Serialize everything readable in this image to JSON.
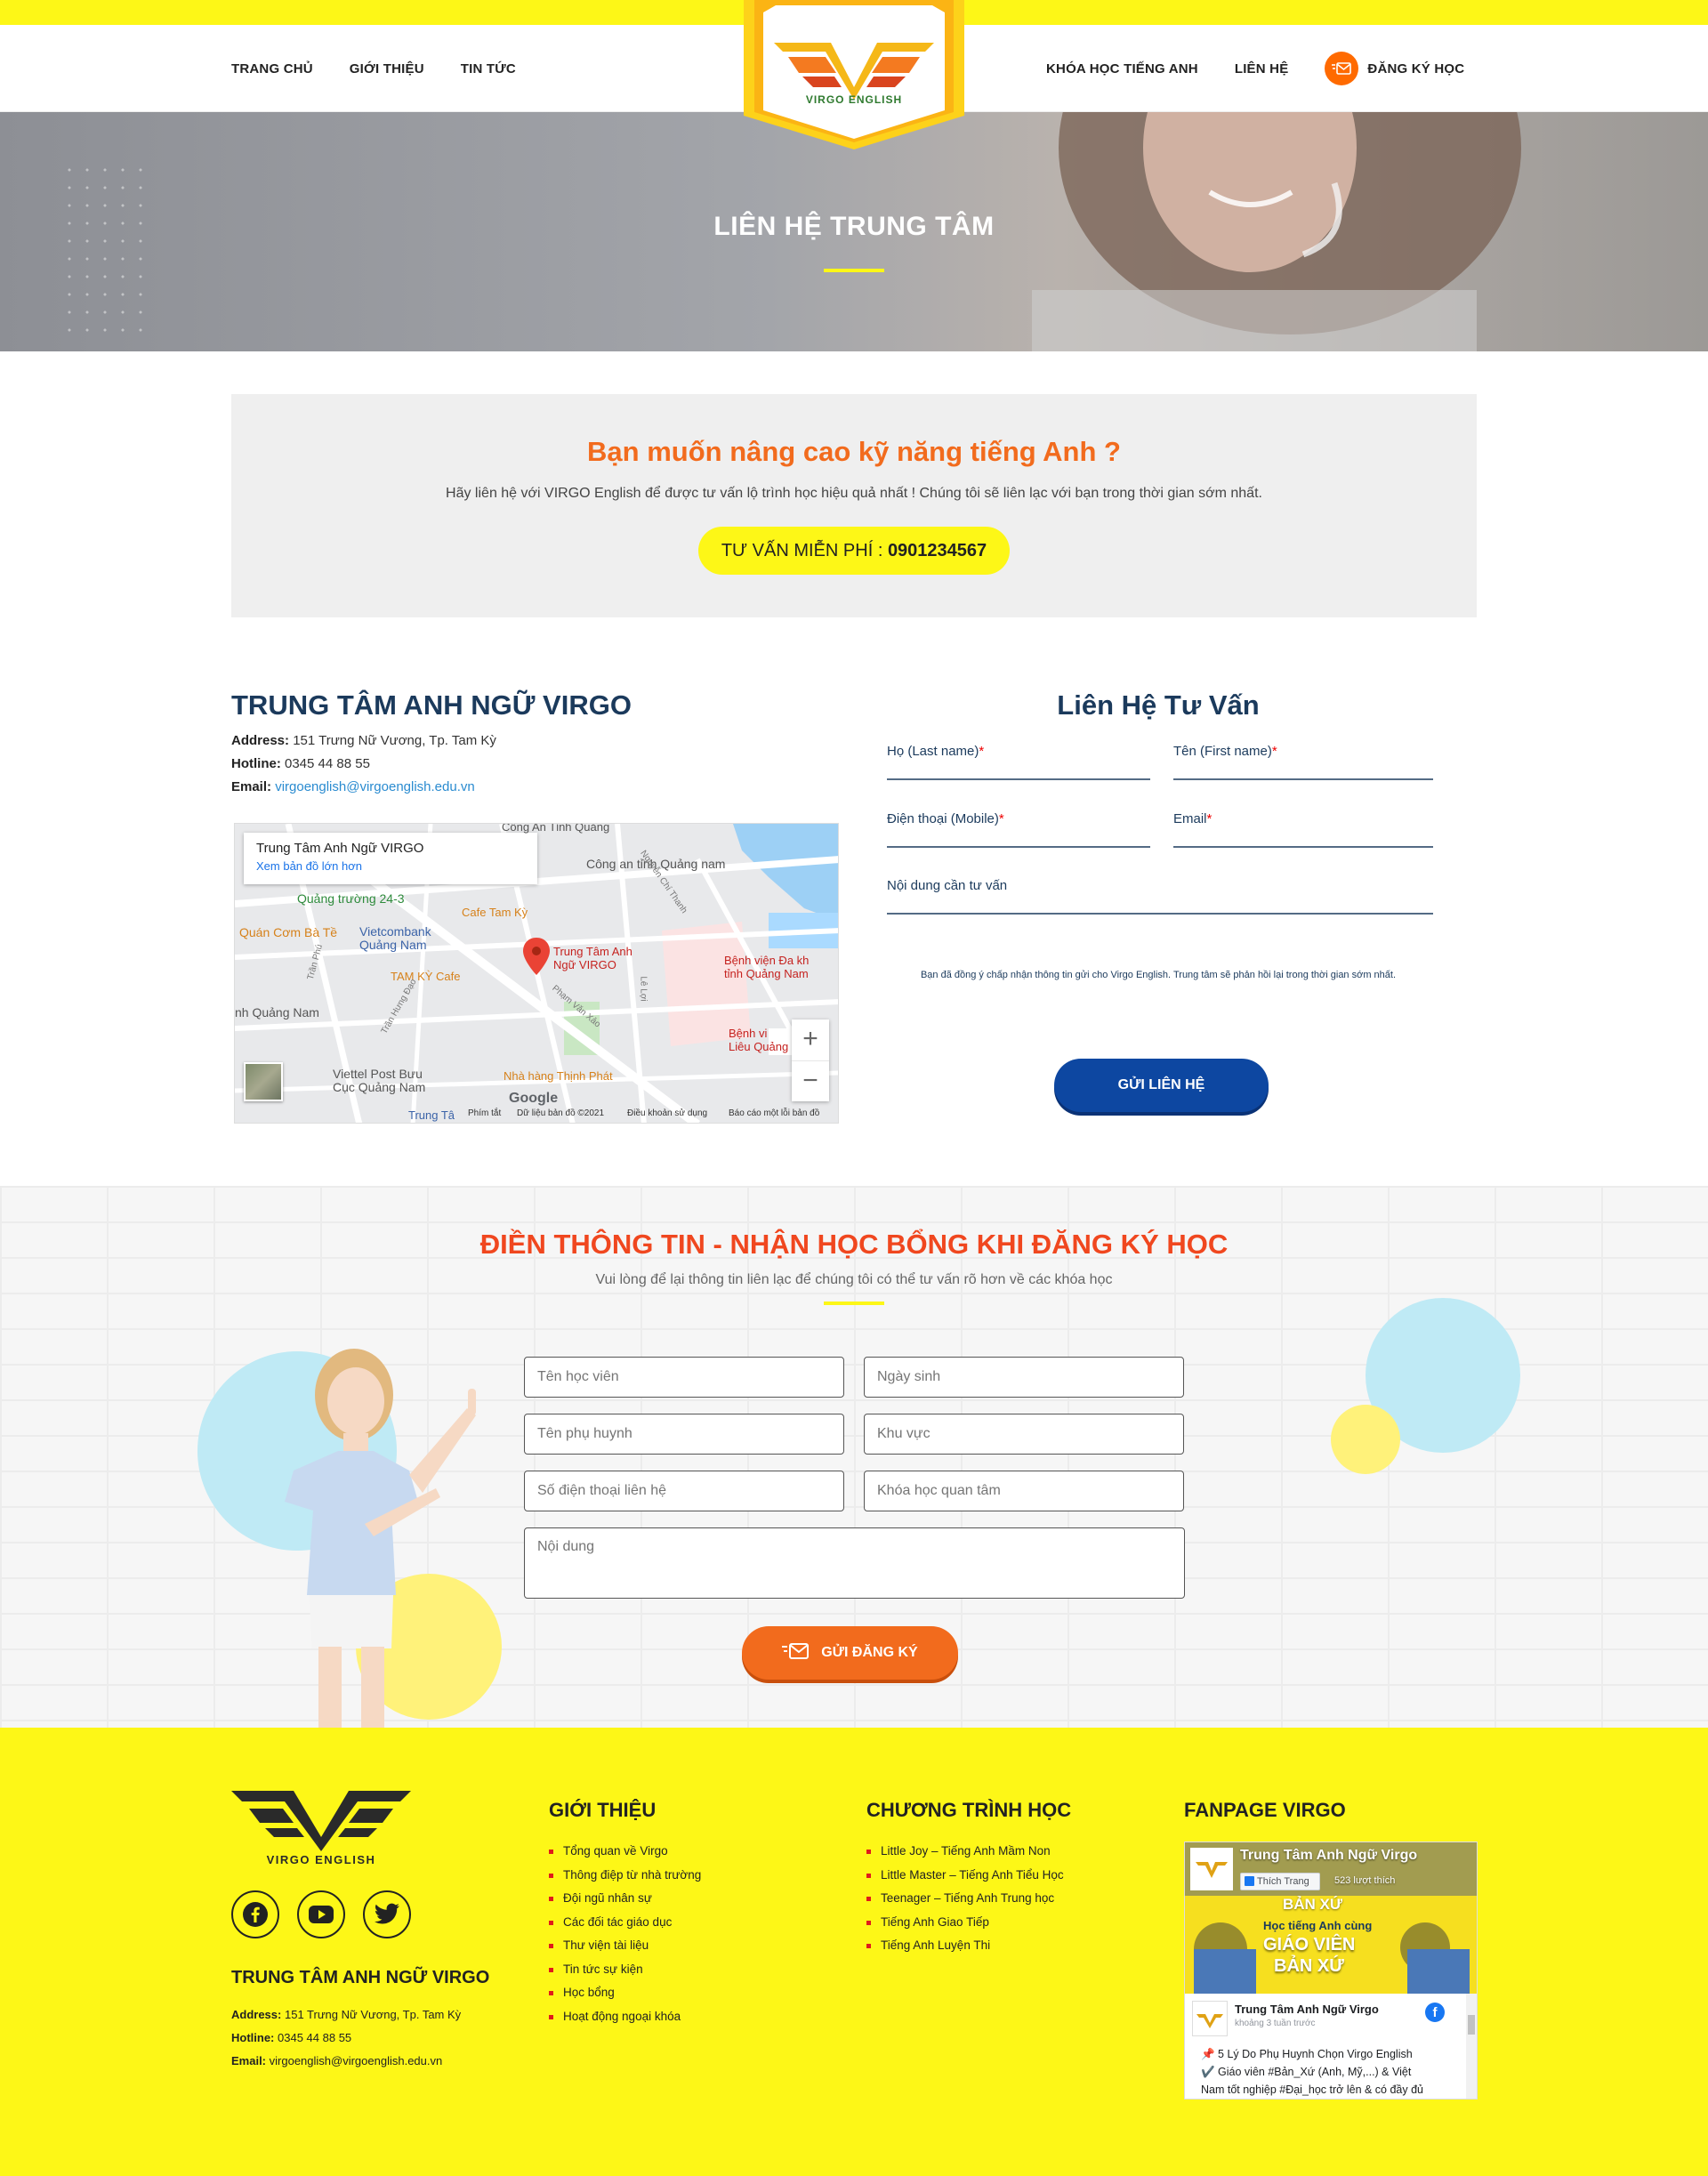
{
  "header": {
    "nav_left": [
      "TRANG CHỦ",
      "GIỚI THIỆU",
      "TIN TỨC"
    ],
    "nav_right": [
      "KHÓA HỌC TIẾNG ANH",
      "LIÊN HỆ"
    ],
    "register": "ĐĂNG KÝ HỌC",
    "logo_text": "VIRGO ENGLISH"
  },
  "hero": {
    "title": "LIÊN HỆ TRUNG TÂM"
  },
  "cta": {
    "title": "Bạn muốn nâng cao kỹ năng tiếng Anh ?",
    "description": "Hãy liên hệ với VIRGO English để được tư vấn lộ trình học hiệu quả nhất ! Chúng tôi sẽ liên lạc với bạn trong thời gian sớm nhất.",
    "button_prefix": "TƯ VẤN MIỄN PHÍ : ",
    "button_phone": "0901234567"
  },
  "contact_info": {
    "title": "TRUNG TÂM ANH NGỮ VIRGO",
    "address_label": "Address:",
    "address": "151 Trưng Nữ Vương, Tp. Tam Kỳ",
    "hotline_label": "Hotline:",
    "hotline": "0345 44 88 55",
    "email_label": "Email:",
    "email": "virgoenglish@virgoenglish.edu.vn"
  },
  "map": {
    "card_title": "Trung Tâm Anh Ngữ VIRGO",
    "card_link": "Xem bản đồ lớn hơn",
    "labels": {
      "cong_an": "Công an tỉnh Quảng nam",
      "quang_truong": "Quảng trường 24-3",
      "cafe_tam_ky": "Cafe Tam Kỳ",
      "quan_com": "Quán Cơm Bà Tề",
      "vietcombank": "Vietcombank\nQuảng Nam",
      "pin_label": "Trung Tâm Anh\nNgữ VIRGO",
      "benh_vien": "Bệnh viện Đa kh\ntỉnh Quảng Nam",
      "tam_ky_cafe": "TAM KỲ Cafe",
      "nh_quang_nam": "nh Quảng Nam",
      "viettel": "Viettel Post Bưu\nCục Quảng Nam",
      "nha_hang": "Nhà hàng Thịnh Phát",
      "benh_vi2": "Bệnh vi\nLiêu Quảng",
      "street1": "Nguyễn Chí Thanh",
      "street2": "Phạm Văn Xảo",
      "street3": "Lê Lợi",
      "street4": "Trần Hưng Đạo",
      "street5": "Trần Phú",
      "top_cut": "Công An Tỉnh Quảng",
      "bottom_cut": "Trung Tâ",
      "google": "Google"
    },
    "zoom_in": "+",
    "zoom_out": "−",
    "footer_items": [
      "Phím tắt",
      "Dữ liệu bản đồ ©2021",
      "Điều khoản sử dụng",
      "Báo cáo một lỗi bản đồ"
    ]
  },
  "consult_form": {
    "title": "Liên Hệ Tư Vấn",
    "last_name": "Họ (Last name)",
    "first_name": "Tên (First name)",
    "phone": "Điện thoại (Mobile)",
    "email": "Email",
    "message": "Nội dung cần tư vấn",
    "required_mark": "*",
    "consent": "Bạn đã đồng ý chấp nhận thông tin gửi cho Virgo English. Trung tâm sẽ phản hồi lại trong thời gian sớm nhất.",
    "submit": "GỬI LIÊN HỆ"
  },
  "scholarship": {
    "title": "ĐIỀN THÔNG TIN - NHẬN HỌC BỔNG KHI ĐĂNG KÝ HỌC",
    "subtitle": "Vui lòng để lại thông tin liên lạc để chúng tôi có thể tư vấn rõ hơn về các khóa học",
    "placeholders": {
      "student_name": "Tên học viên",
      "dob": "Ngày sinh",
      "parent_name": "Tên phụ huynh",
      "area": "Khu vực",
      "phone": "Số điện thoại liên hệ",
      "course": "Khóa học quan tâm",
      "content": "Nội dung"
    },
    "submit": "GỬI ĐĂNG KÝ"
  },
  "footer": {
    "logo_text": "VIRGO ENGLISH",
    "name": "TRUNG TÂM ANH NGỮ VIRGO",
    "address_label": "Address:",
    "address": "151 Trưng Nữ Vương, Tp. Tam Kỳ",
    "hotline_label": "Hotline:",
    "hotline": "0345 44 88 55",
    "email_label": "Email:",
    "email": "virgoenglish@virgoenglish.edu.vn",
    "about": {
      "title": "GIỚI THIỆU",
      "items": [
        "Tổng quan về Virgo",
        "Thông điệp từ nhà trường",
        "Đội ngũ nhân sự",
        "Các đối tác giáo dục",
        "Thư viện tài liệu",
        "Tin tức sự kiện",
        "Học bổng",
        "Hoạt động ngoại khóa"
      ]
    },
    "programs": {
      "title": "CHƯƠNG TRÌNH HỌC",
      "items": [
        "Little Joy – Tiếng Anh Mầm Non",
        "Little Master – Tiếng Anh Tiểu Học",
        "Teenager – Tiếng Anh Trung học",
        "Tiếng Anh Giao Tiếp",
        "Tiếng Anh Luyện Thi"
      ]
    },
    "fanpage": {
      "title": "FANPAGE VIRGO",
      "page_name": "Trung Tâm Anh Ngữ Virgo",
      "like_button": "Thích Trang",
      "likes": "523 lượt thích",
      "banner_line1": "BẢN XỨ",
      "banner_line2": "Học tiếng Anh cùng",
      "banner_line3": "GIÁO VIÊN",
      "banner_line4": "BẢN XỨ",
      "post_author": "Trung Tâm Anh Ngữ Virgo",
      "post_time": "khoảng 3 tuần trước",
      "post_line1": "📌 5 Lý Do Phụ Huynh Chọn Virgo English",
      "post_line2": "✔️ Giáo viên #Bản_Xứ (Anh, Mỹ,...) & Việt",
      "post_line3": "Nam tốt nghiệp #Đại_học trở lên & có đầy đủ"
    }
  },
  "colors": {
    "brand_yellow": "#fdf717",
    "brand_orange": "#f26b1d",
    "brand_navy": "#1b3a5c",
    "brand_blue": "#0d47a1",
    "scholar_title": "#f0471f"
  }
}
